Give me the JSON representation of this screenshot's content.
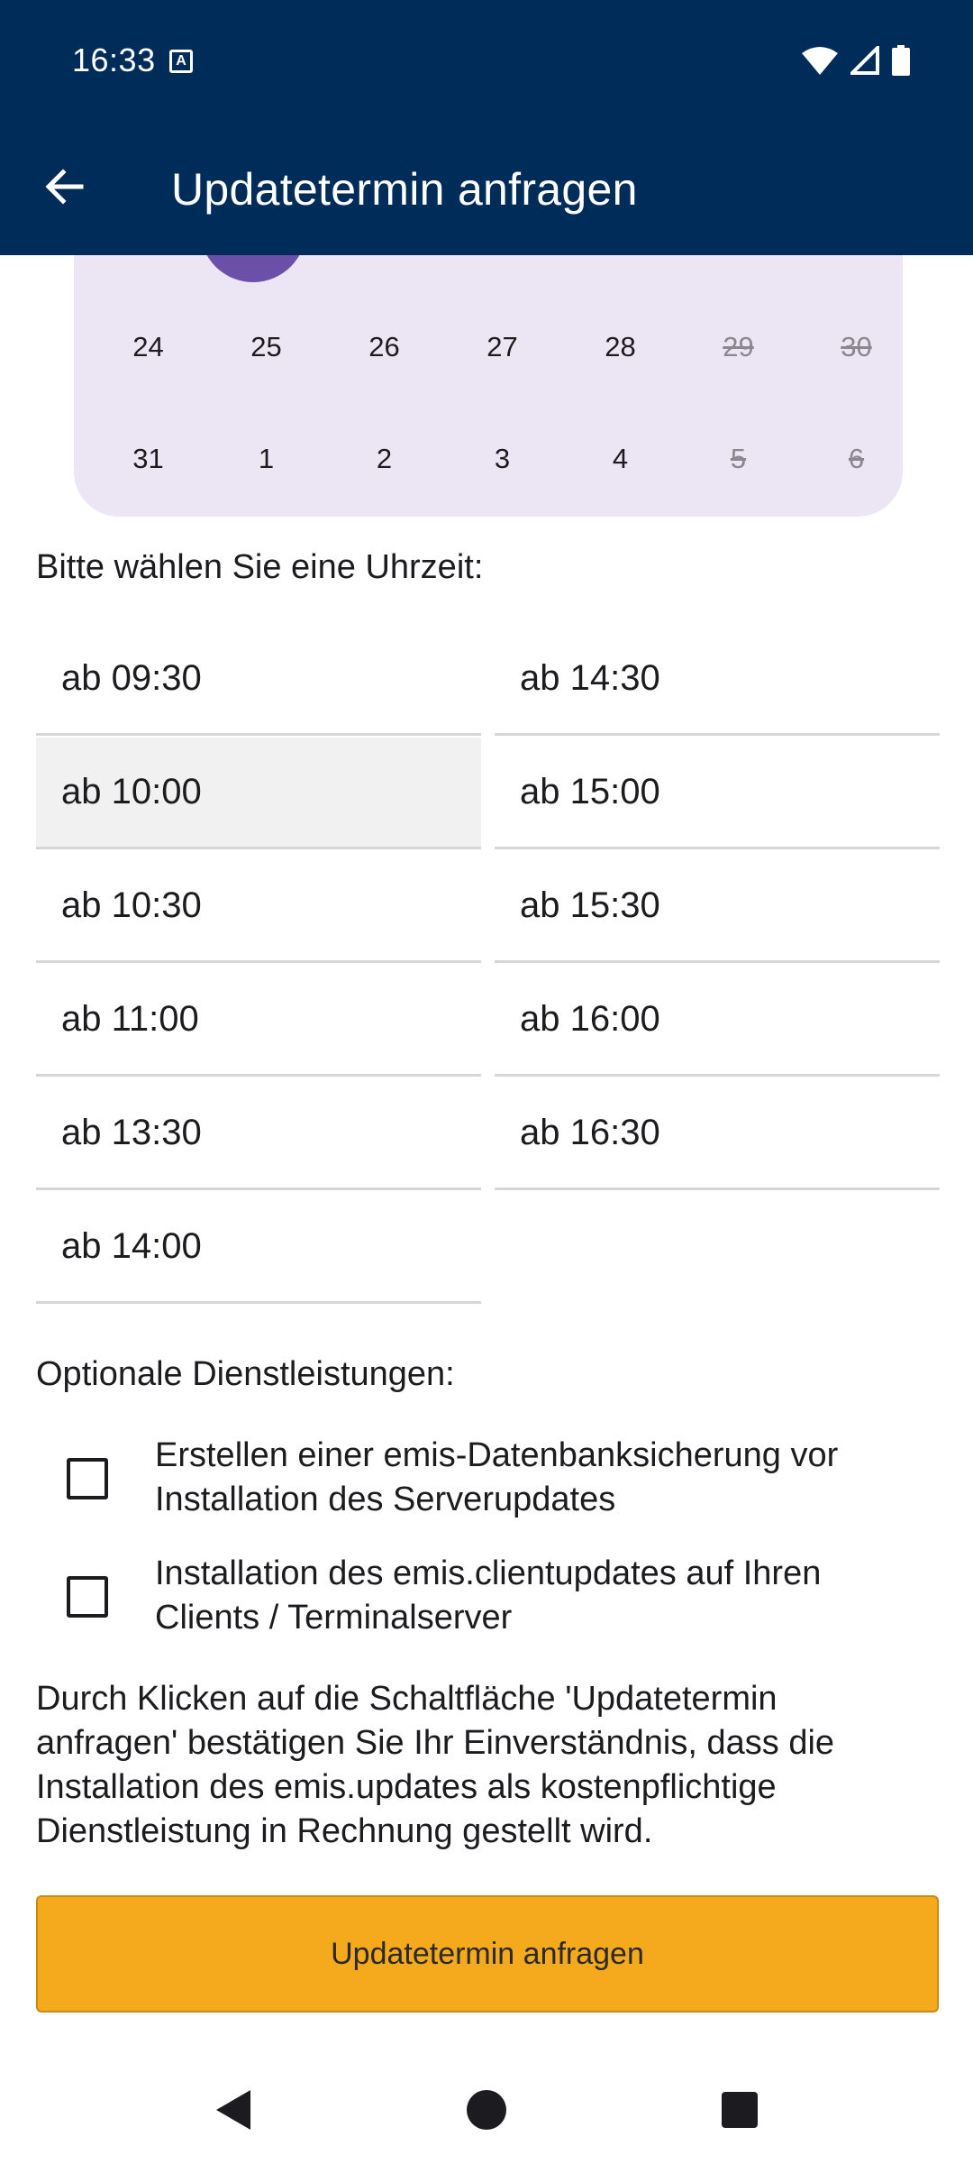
{
  "status_bar": {
    "time": "16:33",
    "icons": [
      "a-notification-icon",
      "wifi-icon",
      "signal-icon",
      "battery-icon"
    ]
  },
  "app_bar": {
    "title": "Updatetermin anfragen",
    "back_icon": "arrow-back-icon"
  },
  "calendar": {
    "rows": [
      [
        {
          "day": "24",
          "disabled": false
        },
        {
          "day": "25",
          "disabled": false
        },
        {
          "day": "26",
          "disabled": false
        },
        {
          "day": "27",
          "disabled": false
        },
        {
          "day": "28",
          "disabled": false
        },
        {
          "day": "29",
          "disabled": true
        },
        {
          "day": "30",
          "disabled": true
        }
      ],
      [
        {
          "day": "31",
          "disabled": false
        },
        {
          "day": "1",
          "disabled": false
        },
        {
          "day": "2",
          "disabled": false
        },
        {
          "day": "3",
          "disabled": false
        },
        {
          "day": "4",
          "disabled": false
        },
        {
          "day": "5",
          "disabled": true
        },
        {
          "day": "6",
          "disabled": true
        }
      ]
    ]
  },
  "time_section": {
    "label": "Bitte wählen Sie eine Uhrzeit:",
    "left": [
      "ab 09:30",
      "ab 10:00",
      "ab 10:30",
      "ab 11:00",
      "ab 13:30",
      "ab 14:00"
    ],
    "right": [
      "ab 14:30",
      "ab 15:00",
      "ab 15:30",
      "ab 16:00",
      "ab 16:30"
    ],
    "highlighted": "ab 10:00"
  },
  "services": {
    "label": "Optionale Dienstleistungen:",
    "options": [
      {
        "lines": [
          "Erstellen einer emis-Datenbanksicherung vor",
          "Installation des Serverupdates"
        ],
        "checked": false
      },
      {
        "lines": [
          "Installation des emis.clientupdates auf Ihren",
          "Clients / Terminalserver"
        ],
        "checked": false
      }
    ]
  },
  "notice": {
    "lines": [
      "Durch Klicken auf die Schaltfläche 'Updatetermin",
      "anfragen' bestätigen Sie Ihr Einverständnis, dass die",
      "Installation des emis.updates als kostenpflichtige",
      "Dienstleistung in Rechnung gestellt wird."
    ]
  },
  "submit": {
    "label": "Updatetermin anfragen"
  },
  "nav": {
    "back_icon": "nav-back-icon",
    "home_icon": "nav-home-icon",
    "recents_icon": "nav-recents-icon"
  },
  "colors": {
    "primary": "#002c5a",
    "accent": "#f5a91c",
    "calendar_bg": "#ece6f4",
    "selected_day": "#6c4fa8"
  }
}
